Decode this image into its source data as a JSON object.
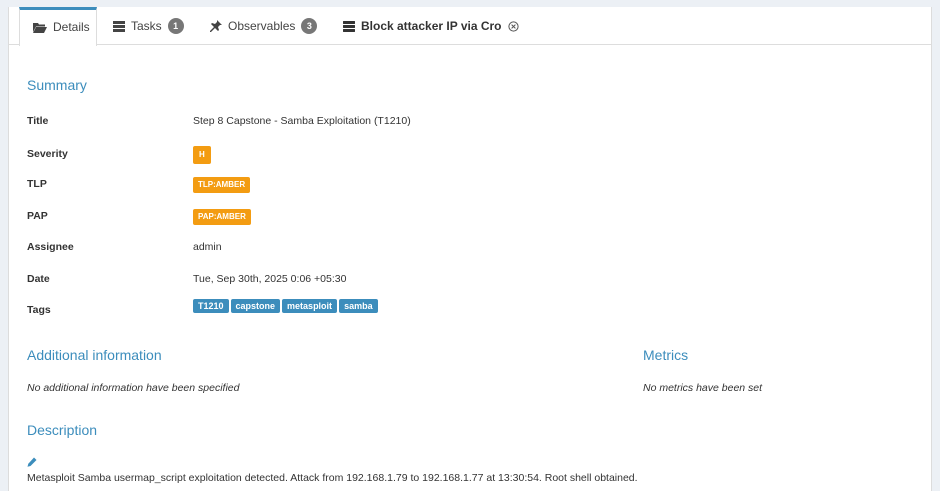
{
  "tabs": [
    {
      "label": "Details",
      "icon": "folder-open-icon",
      "active": true
    },
    {
      "label": "Tasks",
      "icon": "tasks-icon",
      "badge": "1"
    },
    {
      "label": "Observables",
      "icon": "pin-icon",
      "badge": "3"
    },
    {
      "label": "Block attacker IP via Cro",
      "icon": "server-icon",
      "closable": true
    }
  ],
  "summary": {
    "heading": "Summary",
    "title_label": "Title",
    "title_value": "Step 8 Capstone - Samba Exploitation (T1210)",
    "severity_label": "Severity",
    "severity_value": "H",
    "tlp_label": "TLP",
    "tlp_value": "TLP:AMBER",
    "pap_label": "PAP",
    "pap_value": "PAP:AMBER",
    "assignee_label": "Assignee",
    "assignee_value": "admin",
    "date_label": "Date",
    "date_value": "Tue, Sep 30th, 2025 0:06 +05:30",
    "tags_label": "Tags",
    "tags": [
      "T1210",
      "capstone",
      "metasploit",
      "samba"
    ]
  },
  "additional": {
    "heading": "Additional information",
    "empty_text": "No additional information have been specified"
  },
  "metrics": {
    "heading": "Metrics",
    "empty_text": "No metrics have been set"
  },
  "description": {
    "heading": "Description",
    "text": "Metasploit Samba usermap_script exploitation detected. Attack from 192.168.1.79 to 192.168.1.77 at 13:30:54. Root shell obtained."
  },
  "colors": {
    "accent": "#3c8dbc",
    "amber": "#f39c12",
    "badge": "#777777"
  }
}
